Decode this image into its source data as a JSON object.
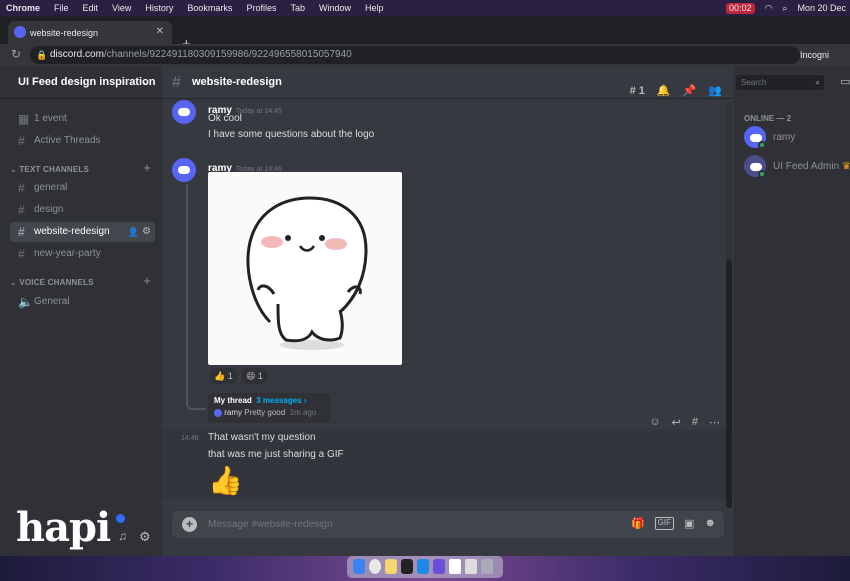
{
  "mac_menu": {
    "app": "Chrome",
    "items": [
      "File",
      "Edit",
      "View",
      "History",
      "Bookmarks",
      "Profiles",
      "Tab",
      "Window",
      "Help"
    ],
    "rec_time": "00:02",
    "date": "Mon 20 Dec"
  },
  "browser": {
    "tab_title": "website-redesign",
    "url_host": "discord.com",
    "url_path": "/channels/922491180309159986/922496558015057940",
    "profile": "Incogni"
  },
  "server": {
    "name": "UI Feed design inspiration",
    "events": "1 event",
    "active_threads": "Active Threads",
    "text_category": "TEXT CHANNELS",
    "text_channels": [
      "general",
      "design",
      "website-redesign",
      "new-year-party"
    ],
    "voice_category": "VOICE CHANNELS",
    "voice_channels": [
      "General"
    ]
  },
  "channel": {
    "name": "website-redesign",
    "threads_count": "1",
    "search_placeholder": "Search"
  },
  "messages": {
    "g1": {
      "author": "ramy",
      "time": "Today at 14:45",
      "lines": [
        "Ok cool",
        "I have some questions about the logo"
      ]
    },
    "g2": {
      "author": "ramy",
      "time": "Today at 14:46"
    },
    "reactions": [
      {
        "emoji": "👍",
        "count": "1"
      },
      {
        "emoji": "😄",
        "count": "1"
      }
    ],
    "thread": {
      "name": "My thread",
      "count": "3 messages ›",
      "last_author": "ramy",
      "last_text": "Pretty good",
      "last_time": "1m ago"
    },
    "g3_time": "14:46",
    "g3_lines": [
      "That wasn't my question",
      "that was me just sharing a GIF"
    ],
    "thumbs": "👍"
  },
  "composer": {
    "placeholder": "Message #website-redesign"
  },
  "members": {
    "header": "ONLINE — 2",
    "list": [
      {
        "name": "ramy"
      },
      {
        "name": "UI Feed Admin",
        "badge": "♛"
      }
    ]
  },
  "watermark": {
    "text": "hapi"
  }
}
